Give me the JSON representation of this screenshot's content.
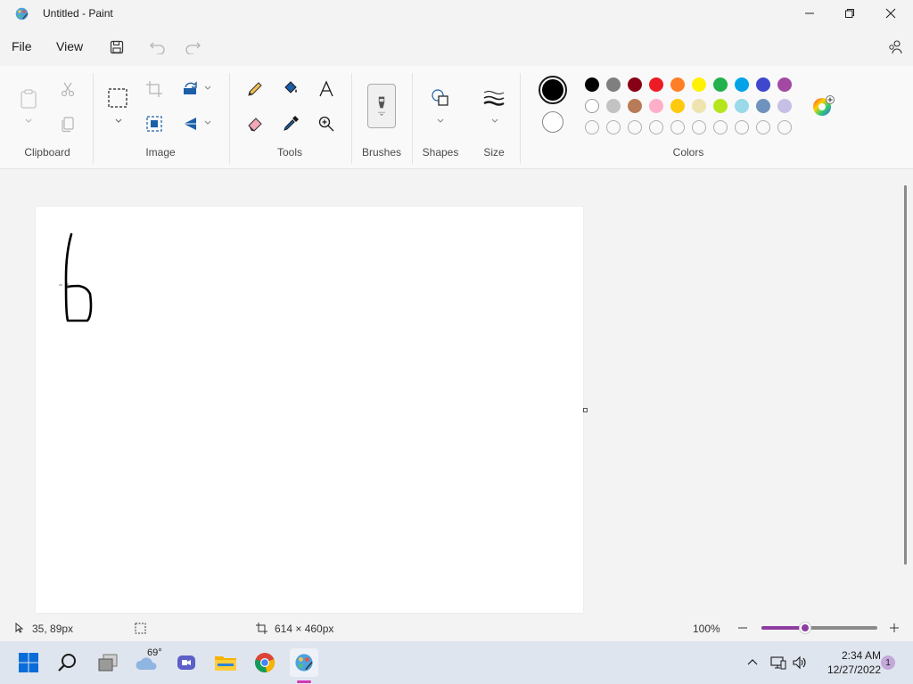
{
  "window": {
    "title": "Untitled - Paint"
  },
  "menu": {
    "file": "File",
    "view": "View"
  },
  "ribbon": {
    "groups": {
      "clipboard": "Clipboard",
      "image": "Image",
      "tools": "Tools",
      "brushes": "Brushes",
      "shapes": "Shapes",
      "size": "Size",
      "colors": "Colors"
    },
    "primary_color": "#000000",
    "secondary_color": "#ffffff",
    "palette_row1": [
      "#000000",
      "#7f7f7f",
      "#880015",
      "#ed1c24",
      "#ff7f27",
      "#fff200",
      "#22b14c",
      "#00a2e8",
      "#3f48cc",
      "#a349a4"
    ],
    "palette_row2": [
      "#ffffff",
      "#c3c3c3",
      "#b97a57",
      "#ffaec9",
      "#ffc90e",
      "#efe4b0",
      "#b5e61d",
      "#99d9ea",
      "#7092be",
      "#c8bfe7"
    ]
  },
  "status": {
    "cursor_pos": "35, 89px",
    "canvas_size": "614 × 460px",
    "zoom": "100%",
    "zoom_level": 0.38
  },
  "taskbar": {
    "weather_temp": "69°",
    "time": "2:34 AM",
    "date": "12/27/2022",
    "notification_count": "1"
  }
}
